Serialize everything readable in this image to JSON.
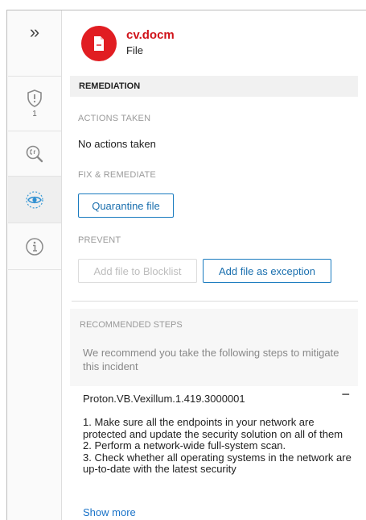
{
  "rail": {
    "expand_glyph": "»",
    "alert_count": "1",
    "icons": [
      "expand-icon",
      "shield-alert-icon",
      "inspect-icon",
      "eye-icon",
      "info-icon"
    ]
  },
  "file": {
    "name": "cv.docm",
    "type": "File",
    "accent": "#e11d22"
  },
  "remediation": {
    "title": "REMEDIATION",
    "actions_taken_caption": "ACTIONS TAKEN",
    "actions_taken_text": "No actions taken",
    "fix_caption": "FIX & REMEDIATE",
    "quarantine_label": "Quarantine file",
    "prevent_caption": "PREVENT",
    "blocklist_label": "Add file to Blocklist",
    "exception_label": "Add file as exception"
  },
  "recommended": {
    "title": "RECOMMENDED STEPS",
    "intro": "We recommend you take the following steps to mitigate this incident",
    "step_title": "Proton.VB.Vexillum.1.419.3000001",
    "collapse_glyph": "−",
    "steps_text": "1. Make sure all the endpoints in your network are protected and update the security solution on all of them\n2. Perform a network-wide full-system scan.\n3. Check whether all operating systems in the network are up-to-date with the latest security",
    "show_more": "Show more"
  },
  "colors": {
    "link": "#1a73c8",
    "primary_border": "#1a7bbf",
    "danger": "#d0131a"
  }
}
